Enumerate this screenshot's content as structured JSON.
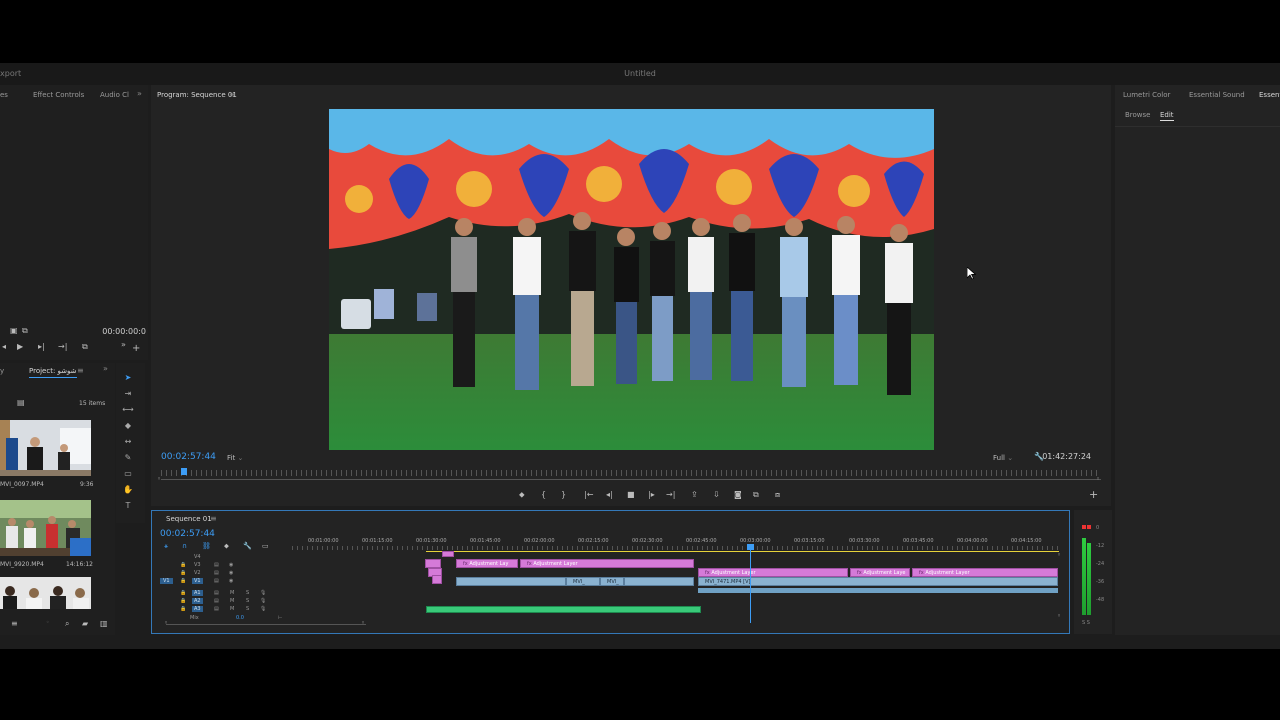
{
  "app": {
    "left_title": "xport",
    "title": "Untitled"
  },
  "source_panel": {
    "tabs": [
      "es",
      "Effect Controls",
      "Audio Cl"
    ],
    "expand": "»",
    "timecode": "00:00:00:0"
  },
  "program": {
    "title": "Program: Sequence 01",
    "timecode": "00:02:57:44",
    "fit": "Fit",
    "quality": "Full",
    "duration": "01:42:27:24"
  },
  "right_panel": {
    "tabs": [
      "Lumetri Color",
      "Essential Sound",
      "Essenti"
    ],
    "subtabs": [
      "Browse",
      "Edit"
    ]
  },
  "project": {
    "tab_left": "y",
    "tab_title": "Project: شوشو",
    "items_count": "15 items",
    "items": [
      {
        "name": "MVI_0097.MP4",
        "duration": "9:36"
      },
      {
        "name": "MVI_9920.MP4",
        "duration": "14:16:12"
      },
      {
        "name": "",
        "duration": ""
      }
    ]
  },
  "timeline": {
    "title": "Sequence 01",
    "timecode": "00:02:57:44",
    "ruler": [
      "00:01:00:00",
      "00:01:15:00",
      "00:01:30:00",
      "00:01:45:00",
      "00:02:00:00",
      "00:02:15:00",
      "00:02:30:00",
      "00:02:45:00",
      "00:03:00:00",
      "00:03:15:00",
      "00:03:30:00",
      "00:03:45:00",
      "00:04:00:00",
      "00:04:15:00"
    ],
    "video_tracks": [
      "V4",
      "V3",
      "V2",
      "V1"
    ],
    "audio_tracks": [
      "A1",
      "A2",
      "A3",
      "Mix"
    ],
    "mix_value": "0.0",
    "clips": {
      "adj1": "Adjustment Lay",
      "adj2": "Adjustment Layer",
      "adj3": "Adjustment Layer",
      "adj4": "Adjustment Laye",
      "adj5": "Adjustment Layer",
      "mvi_a": "MVI_",
      "mvi_b": "MVI_",
      "mvi_c": "MVI_7471.MP4 [V]",
      "fx": "fx"
    }
  },
  "meters": {
    "labels": [
      "0",
      "-12",
      "-24",
      "-36",
      "-48"
    ],
    "solo": "S S"
  },
  "colors": {
    "accent": "#3d9df5",
    "timeline_border": "#3478b8",
    "pink_clip": "#d57ad8",
    "green_clip": "#39c979",
    "blue_clip": "#8ab2d0"
  }
}
